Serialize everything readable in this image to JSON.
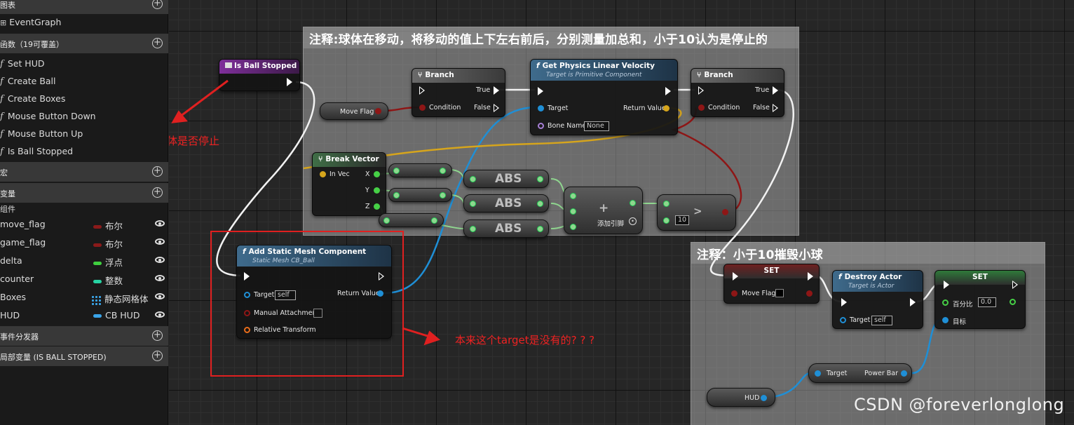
{
  "left_panel": {
    "graphs_header": "图表",
    "event_graph": "EventGraph",
    "functions_header": "函数（19可覆盖）",
    "functions": [
      "Set HUD",
      "Create Ball",
      "Create Boxes",
      "Mouse Button Down",
      "Mouse Button Up",
      "Is Ball Stopped"
    ],
    "macros_header": "宏",
    "variables_header": "变量",
    "components_label": "组件",
    "variables": [
      {
        "name": "move_flag",
        "type": "布尔",
        "color": "#8b1a1a"
      },
      {
        "name": "game_flag",
        "type": "布尔",
        "color": "#8b1a1a"
      },
      {
        "name": "delta",
        "type": "浮点",
        "color": "#3fcf3f"
      },
      {
        "name": "counter",
        "type": "整数",
        "color": "#27d3a3"
      },
      {
        "name": "Boxes",
        "type": "静态网格体",
        "color": "#3aa4e8"
      },
      {
        "name": "HUD",
        "type": "CB HUD",
        "color": "#3aa4e8"
      }
    ],
    "dispatchers_header": "事件分发器",
    "locals_header": "局部变量 (IS BALL STOPPED)"
  },
  "graph": {
    "comment1_title": "注释:球体在移动，将移动的值上下左右前后，分别测量加总和，小于10认为是停止的",
    "comment2_title": "注释：小于10摧毁小球",
    "nodes": {
      "entry": {
        "title": "Is Ball Stopped"
      },
      "branch1": {
        "title": "Branch",
        "condition": "Condition",
        "true": "True",
        "false": "False"
      },
      "move_flag_get": {
        "label": "Move Flag"
      },
      "get_velocity": {
        "title": "Get Physics Linear Velocity",
        "subtitle": "Target is Primitive Component",
        "target": "Target",
        "bone_name": "Bone Name",
        "bone_value": "None",
        "return_value": "Return Value"
      },
      "branch2": {
        "title": "Branch",
        "condition": "Condition",
        "true": "True",
        "false": "False"
      },
      "break_vector": {
        "title": "Break Vector",
        "in_vec": "In Vec",
        "x": "X",
        "y": "Y",
        "z": "Z"
      },
      "abs": {
        "label": "ABS"
      },
      "add": {
        "add_pin": "添加引脚"
      },
      "compare": {
        "symbol": ">",
        "value": "10"
      },
      "add_mesh": {
        "title": "Add Static Mesh Component",
        "subtitle": "Static Mesh CB_Ball",
        "target": "Target",
        "target_value": "self",
        "manual": "Manual Attachment",
        "relative": "Relative Transform",
        "return_value": "Return Value"
      },
      "set_move_flag": {
        "title": "SET",
        "label": "Move Flag"
      },
      "destroy_actor": {
        "title": "Destroy Actor",
        "subtitle": "Target is Actor",
        "target": "Target",
        "target_value": "self"
      },
      "set_percent": {
        "title": "SET",
        "percent": "百分比",
        "percent_value": "0.0",
        "target": "目标"
      },
      "power_bar": {
        "target": "Target",
        "label": "Power Bar"
      },
      "hud_get": {
        "label": "HUD"
      }
    },
    "annotation_ball": "检测球体是否停止",
    "annotation_target": "本来这个target是没有的? ? ?"
  },
  "watermark": "CSDN @foreverlonglong",
  "colors": {
    "exec": "#ffffff",
    "bool": "#8b1a1a",
    "object": "#1aa0e6",
    "vector": "#e6b422",
    "float": "#46d046"
  }
}
